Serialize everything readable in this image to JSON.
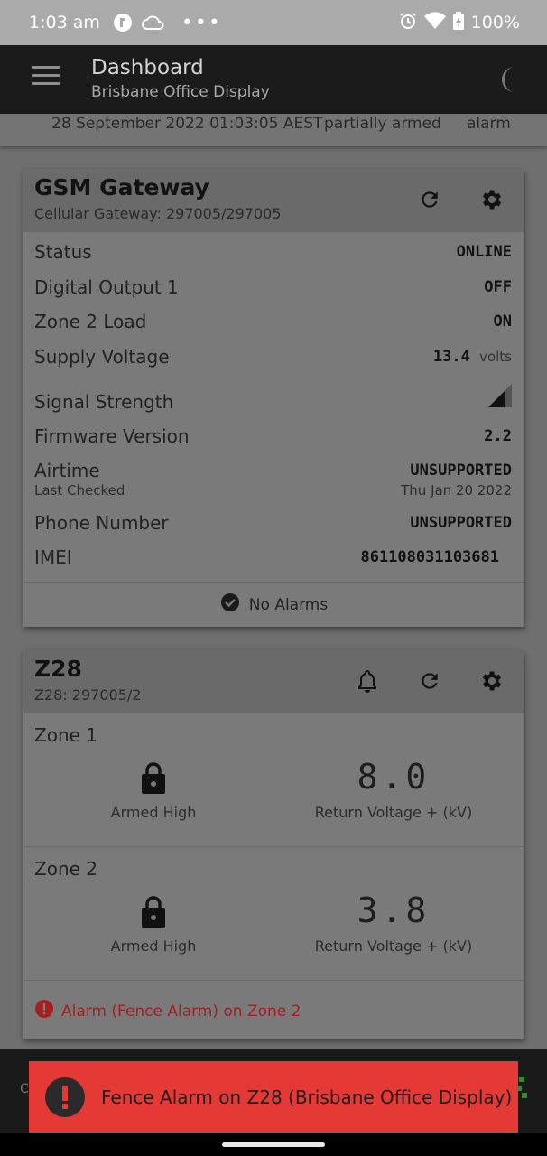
{
  "status_bar": {
    "time": "1:03 am",
    "dots": "•••",
    "battery": "100%"
  },
  "app_bar": {
    "title": "Dashboard",
    "subtitle": "Brisbane Office Display"
  },
  "info_bar": {
    "datetime": "28 September 2022 01:03:05 AEST",
    "arm_state": "partially armed",
    "alarm_state": "alarm"
  },
  "gateway_card": {
    "title": "GSM Gateway",
    "subtitle": "Cellular Gateway: 297005/297005",
    "rows": {
      "status": {
        "label": "Status",
        "value": "ONLINE"
      },
      "digital_output": {
        "label": "Digital Output 1",
        "value": "OFF"
      },
      "zone2_load": {
        "label": "Zone 2 Load",
        "value": "ON"
      },
      "supply_voltage": {
        "label": "Supply Voltage",
        "value": "13.4",
        "unit": "volts"
      },
      "signal": {
        "label": "Signal Strength"
      },
      "firmware": {
        "label": "Firmware Version",
        "value": "2.2"
      },
      "airtime": {
        "label": "Airtime",
        "value": "UNSUPPORTED",
        "sublabel": "Last Checked",
        "subvalue": "Thu Jan 20 2022"
      },
      "phone": {
        "label": "Phone Number",
        "value": "UNSUPPORTED"
      },
      "imei": {
        "label": "IMEI",
        "value": "861108031103681"
      }
    },
    "footer": "No Alarms"
  },
  "z28_card": {
    "title": "Z28",
    "subtitle": "Z28: 297005/2",
    "zones": [
      {
        "label": "Zone 1",
        "arm_label": "Armed High",
        "voltage": "8.0",
        "voltage_label": "Return Voltage + (kV)"
      },
      {
        "label": "Zone 2",
        "arm_label": "Armed High",
        "voltage": "3.8",
        "voltage_label": "Return Voltage + (kV)"
      }
    ],
    "alarm_text": "Alarm (Fence Alarm) on Zone 2"
  },
  "toast": {
    "message": "Fence Alarm on Z28 (Brisbane Office Display)"
  },
  "bottom_nav": {
    "left_edge_text": "C"
  },
  "colors": {
    "alarm_red": "#e53935",
    "alarm_text": "#a51f1f",
    "app_bar": "#1b1b1b"
  },
  "icons": [
    "menu-icon",
    "moon-icon",
    "refresh-icon",
    "gear-icon",
    "bell-icon",
    "lock-icon",
    "check-circle-icon",
    "alert-circle-icon",
    "signal-icon",
    "wifi-icon",
    "battery-icon",
    "alarm-clock-icon"
  ]
}
